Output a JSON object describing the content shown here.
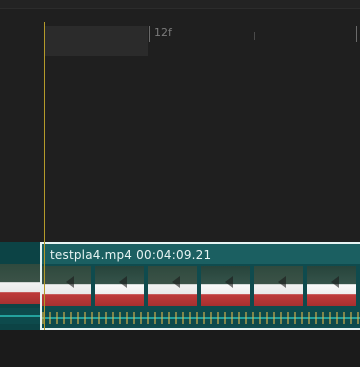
{
  "timeline": {
    "ruler_label": "12f",
    "clip": {
      "filename": "testpla4.mp4",
      "timecode": "00:04:09.21",
      "title": "testpla4.mp4   00:04:09.21"
    }
  },
  "colors": {
    "background": "#1f1f1f",
    "playhead": "#b49a2a",
    "clip_fill": "#0f4b4e",
    "clip_header": "#1b5f61",
    "clip_border": "#e6f3f2",
    "audio_line": "#2bb7b2"
  },
  "icons": {
    "playhead": "playhead-line",
    "video": "video-thumbnail",
    "audio": "audio-waveform"
  }
}
